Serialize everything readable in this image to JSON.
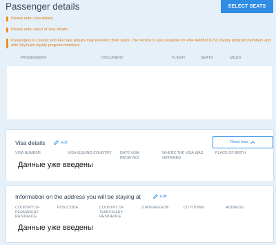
{
  "header": {
    "title": "Passenger details",
    "select_seats": "SELECT SEATS"
  },
  "notices": [
    "Please enter visa details",
    "Please enter place of stay details",
    "Passengers in Classic and Flex fare groups may preselect their seats. The service is also available for elite Aeroflot PJSC loyalty program members and elite SkyTeam loyalty program members."
  ],
  "passenger_table": {
    "columns": [
      "PASSENGERS",
      "DOCUMENT",
      "FLIGHT",
      "SEATS",
      "MILES"
    ]
  },
  "visa": {
    "title": "Visa details",
    "edit": "Edit",
    "read_less": "Read less",
    "columns": [
      "VISA NUMBER",
      "VISA ISSUING COUNTRY",
      "DATE VISA RECEIVED",
      "WHERE THE VISA WAS OBTAINED",
      "PLACE OF BIRTH"
    ],
    "overlay": "Данные уже введены"
  },
  "address": {
    "title": "Information on the address you will be staying at",
    "edit": "Edit",
    "columns": [
      "COUNTRY OF PERMANENT RESIDENCE",
      "POSTCODE",
      "COUNTRY OF TEMPORARY RESIDENCE",
      "STATE/REGION",
      "CITY/TOWN",
      "ADDRESS"
    ],
    "overlay": "Данные уже введены"
  },
  "colors": {
    "accent": "#2f8de4",
    "warning": "#f28c1e",
    "background": "#e6f0f8"
  }
}
